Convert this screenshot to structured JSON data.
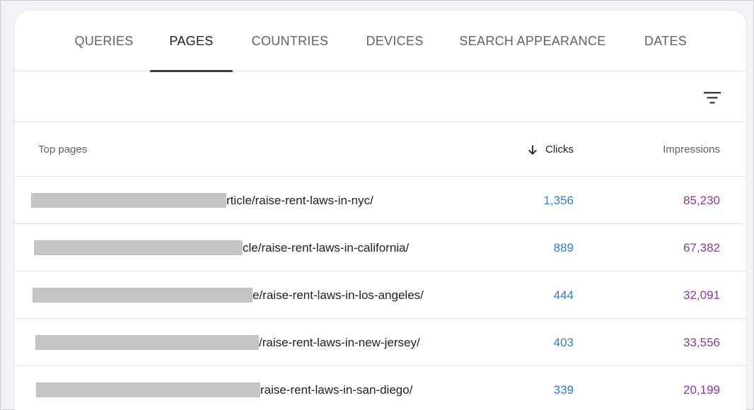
{
  "tabs": [
    {
      "label": "QUERIES",
      "active": false
    },
    {
      "label": "PAGES",
      "active": true
    },
    {
      "label": "COUNTRIES",
      "active": false
    },
    {
      "label": "DEVICES",
      "active": false
    },
    {
      "label": "SEARCH APPEARANCE",
      "active": false
    },
    {
      "label": "DATES",
      "active": false
    }
  ],
  "toolbar": {
    "filter_icon": "filter-list-icon"
  },
  "table": {
    "headers": {
      "pages": "Top pages",
      "clicks": "Clicks",
      "impressions": "Impressions",
      "sort_icon": "arrow-down-icon"
    },
    "rows": [
      {
        "page_suffix": "rticle/raise-rent-laws-in-nyc/",
        "clicks": "1,356",
        "impressions": "85,230"
      },
      {
        "page_suffix": "cle/raise-rent-laws-in-california/",
        "clicks": "889",
        "impressions": "67,382"
      },
      {
        "page_suffix": "e/raise-rent-laws-in-los-angeles/",
        "clicks": "444",
        "impressions": "32,091"
      },
      {
        "page_suffix": "/raise-rent-laws-in-new-jersey/",
        "clicks": "403",
        "impressions": "33,556"
      },
      {
        "page_suffix": "raise-rent-laws-in-san-diego/",
        "clicks": "339",
        "impressions": "20,199"
      }
    ]
  },
  "colors": {
    "clicks": "#2f7dd1",
    "impressions": "#8e35a8",
    "active_tab_indicator": "#3c4043"
  }
}
